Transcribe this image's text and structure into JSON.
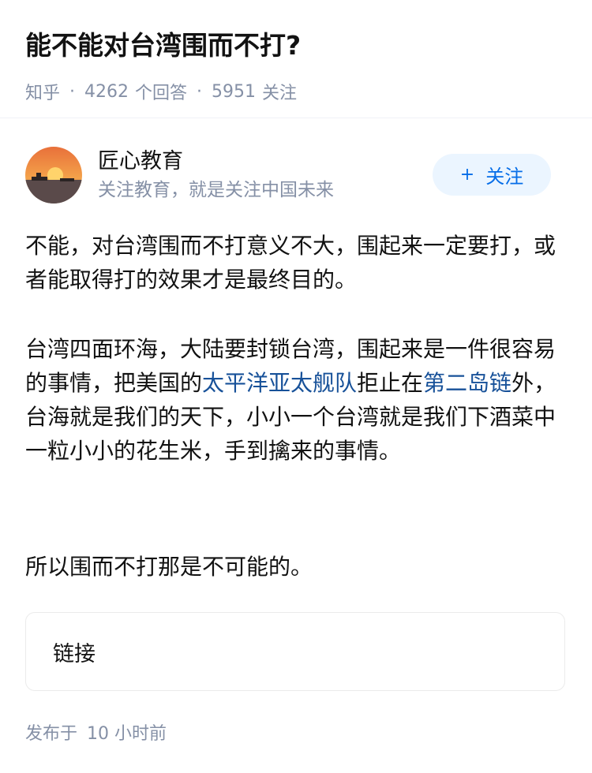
{
  "question": {
    "title": "能不能对台湾围而不打?",
    "source": "知乎",
    "answers_count": "4262",
    "answers_label": "个回答",
    "followers_count": "5951",
    "followers_label": "关注"
  },
  "author": {
    "name": "匠心教育",
    "bio": "关注教育，就是关注中国未来",
    "follow_plus": "+",
    "follow_label": "关注"
  },
  "answer": {
    "p1": "不能，对台湾围而不打意义不大，围起来一定要打，或者能取得打的效果才是最终目的。",
    "p2_a": "台湾四面环海，大陆要封锁台湾，围起来是一件很容易的事情，把美国的",
    "p2_link1": "太平洋亚太舰队",
    "p2_b": "拒止在",
    "p2_link2": "第二岛链",
    "p2_c": "外，台海就是我们的天下，小小一个台湾就是我们下酒菜中一粒小小的花生米，手到擒来的事情。",
    "p3": "所以围而不打那是不可能的。"
  },
  "link_card": {
    "label": "链接"
  },
  "footer": {
    "published_label": "发布于",
    "time": "10 小时前"
  },
  "colors": {
    "link": "#175199",
    "accent": "#056de8",
    "meta": "#8590a6"
  }
}
